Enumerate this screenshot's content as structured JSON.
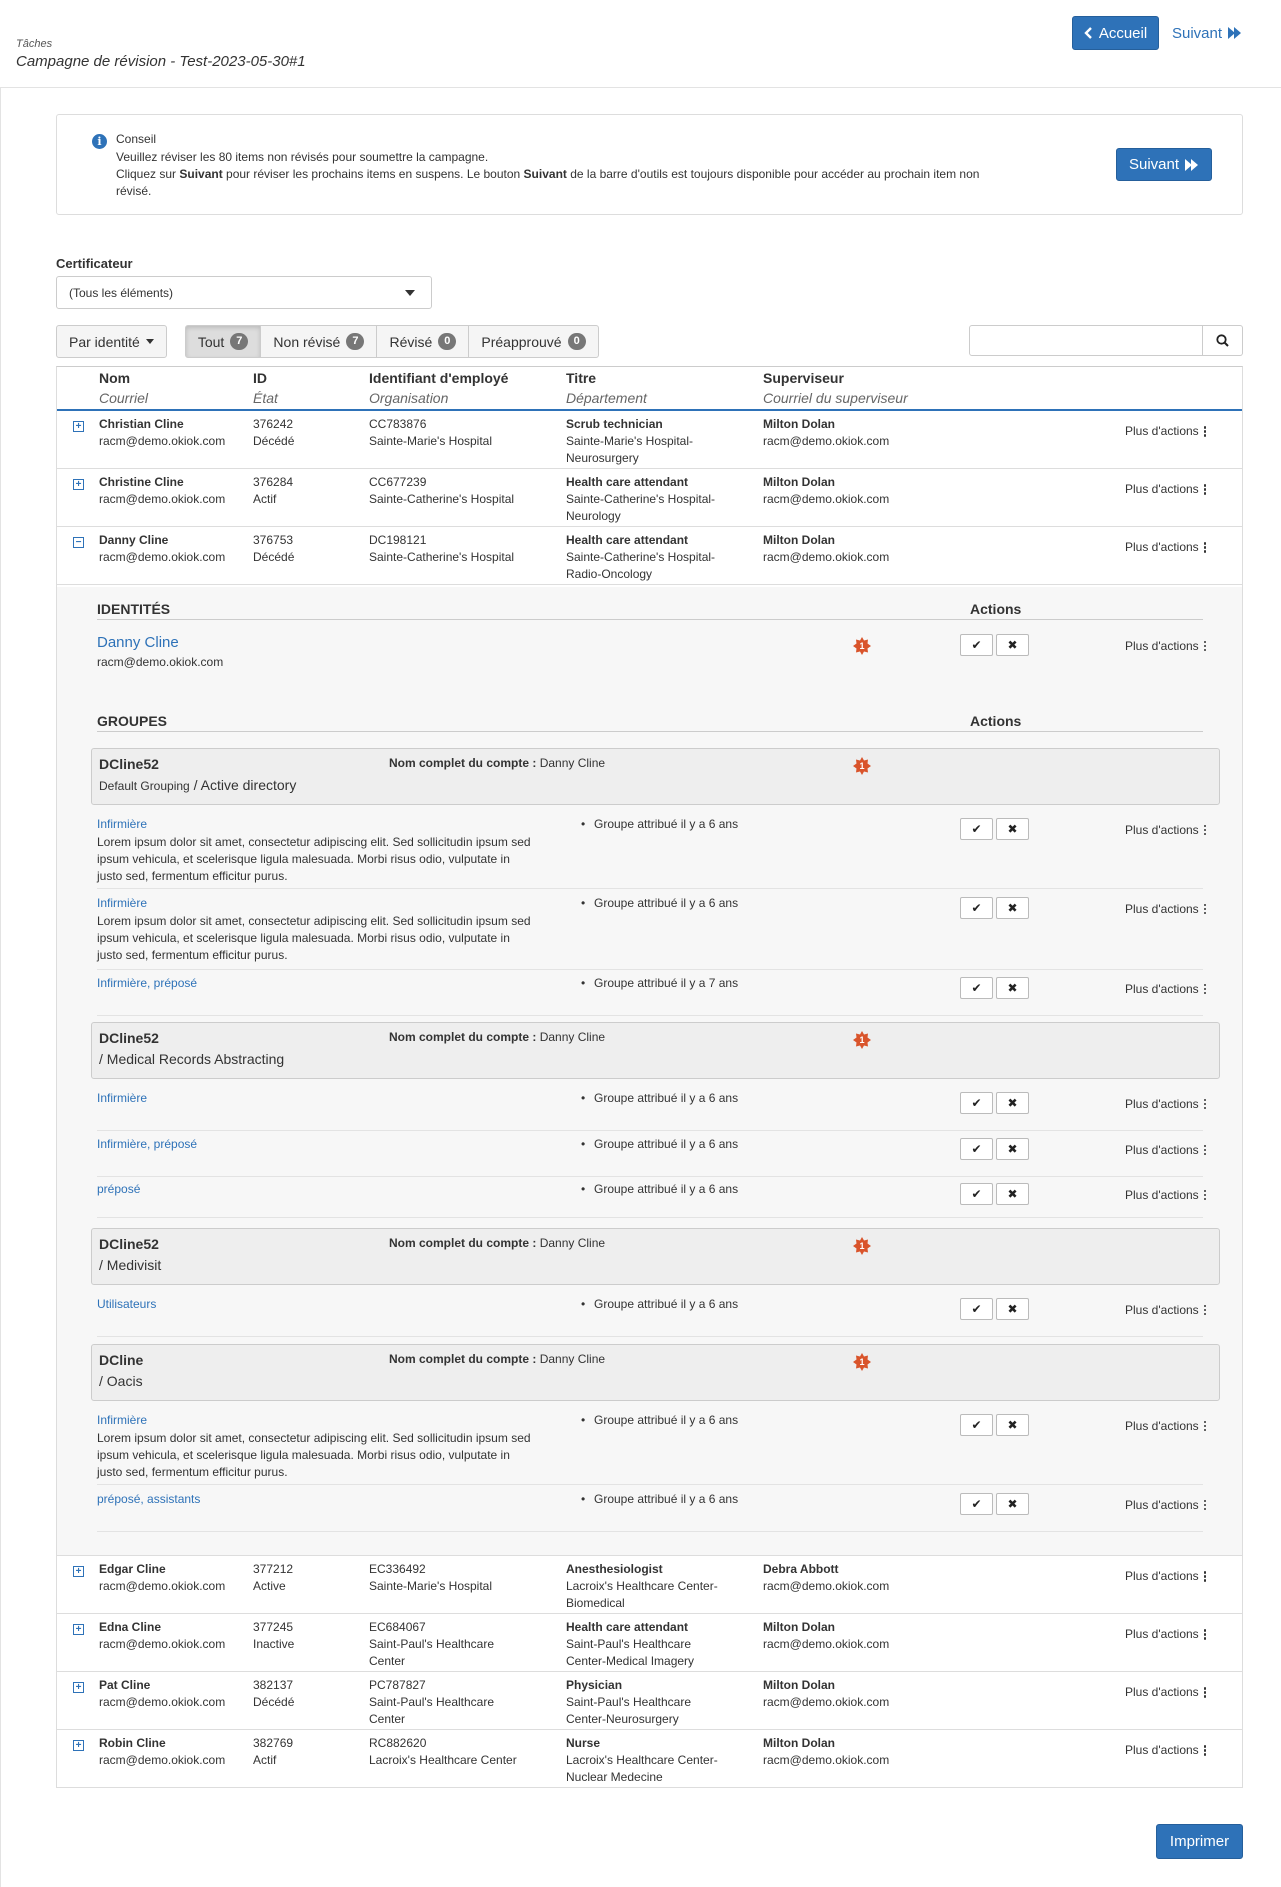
{
  "header": {
    "breadcrumb": "Tâches",
    "title": "Campagne de révision - Test-2023-05-30#1",
    "accueil_label": "Accueil",
    "suivant_label": "Suivant"
  },
  "tip": {
    "title": "Conseil",
    "line1": "Veuillez réviser les 80 items non révisés pour soumettre la campagne.",
    "line2_a": "Cliquez sur ",
    "line2_b": "Suivant",
    "line2_c": " pour réviser les prochains items en suspens. Le bouton ",
    "line2_d": "Suivant",
    "line2_e": " de la barre d'outils est toujours disponible pour accéder au prochain item non révisé.",
    "button_label": "Suivant"
  },
  "certificateur": {
    "label": "Certificateur",
    "selected": "(Tous les éléments)"
  },
  "filters": {
    "par_identite": "Par identité",
    "tout": "Tout",
    "tout_count": "7",
    "non_revise": "Non révisé",
    "non_revise_count": "7",
    "revise": "Révisé",
    "revise_count": "0",
    "preapprouve": "Préapprouvé",
    "preapprouve_count": "0"
  },
  "columns": {
    "nom": "Nom",
    "courriel": "Courriel",
    "id": "ID",
    "etat": "État",
    "employe": "Identifiant d'employé",
    "organisation": "Organisation",
    "titre": "Titre",
    "departement": "Département",
    "superviseur": "Superviseur",
    "courriel_sup": "Courriel du superviseur"
  },
  "more_actions": "Plus d'actions",
  "rows_top": [
    {
      "name": "Christian Cline",
      "email": "racm@demo.okiok.com",
      "id": "376242",
      "state": "Décédé",
      "emp": "CC783876",
      "org": "Sainte-Marie's Hospital",
      "title": "Scrub technician",
      "dept": "Sainte-Marie's Hospital-Neurosurgery",
      "sup": "Milton Dolan",
      "sup_email": "racm@demo.okiok.com",
      "expander": "+"
    },
    {
      "name": "Christine Cline",
      "email": "racm@demo.okiok.com",
      "id": "376284",
      "state": "Actif",
      "emp": "CC677239",
      "org": "Sainte-Catherine's Hospital",
      "title": "Health care attendant",
      "dept": "Sainte-Catherine's Hospital-Neurology",
      "sup": "Milton Dolan",
      "sup_email": "racm@demo.okiok.com",
      "expander": "+"
    },
    {
      "name": "Danny Cline",
      "email": "racm@demo.okiok.com",
      "id": "376753",
      "state": "Décédé",
      "emp": "DC198121",
      "org": "Sainte-Catherine's Hospital",
      "title": "Health care attendant",
      "dept": "Sainte-Catherine's Hospital-Radio-Oncology",
      "sup": "Milton Dolan",
      "sup_email": "racm@demo.okiok.com",
      "expander": "−"
    }
  ],
  "detail": {
    "identites_label": "IDENTITÉS",
    "actions_label": "Actions",
    "identity_name": "Danny Cline",
    "identity_email": "racm@demo.okiok.com",
    "groupes_label": "GROUPES",
    "full_name_label": "Nom complet du compte :",
    "full_name_value": "Danny Cline",
    "burst_count": "1",
    "groups": [
      {
        "name": "DCline52",
        "sub_a": "Default Grouping",
        "sub_b": " / Active directory"
      },
      {
        "name": "DCline52",
        "sub_a": "",
        "sub_b": "/ Medical Records Abstracting"
      },
      {
        "name": "DCline52",
        "sub_a": "",
        "sub_b": "/ Medivisit"
      },
      {
        "name": "DCline",
        "sub_a": "",
        "sub_b": "/ Oacis"
      }
    ],
    "lorem": "Lorem ipsum dolor sit amet, consectetur adipiscing elit. Sed sollicitudin ipsum sed ipsum vehicula, et scelerisque ligula malesuada. Morbi risus odio, vulputate in justo sed, fermentum efficitur purus.",
    "entries": [
      {
        "name": "Infirmière",
        "assigned": "Groupe attribué il y a 6 ans"
      },
      {
        "name": "Infirmière",
        "assigned": "Groupe attribué il y a 6 ans"
      },
      {
        "name": "Infirmière, préposé",
        "assigned": "Groupe attribué il y a 7 ans"
      },
      {
        "name": "Infirmière",
        "assigned": "Groupe attribué il y a 6 ans"
      },
      {
        "name": "Infirmière, préposé",
        "assigned": "Groupe attribué il y a 6 ans"
      },
      {
        "name": "préposé",
        "assigned": "Groupe attribué il y a 6 ans"
      },
      {
        "name": "Utilisateurs",
        "assigned": "Groupe attribué il y a 6 ans"
      },
      {
        "name": "Infirmière",
        "assigned": "Groupe attribué il y a 6 ans"
      },
      {
        "name": "préposé, assistants",
        "assigned": "Groupe attribué il y a 6 ans"
      }
    ]
  },
  "rows_bottom": [
    {
      "name": "Edgar Cline",
      "email": "racm@demo.okiok.com",
      "id": "377212",
      "state": "Active",
      "emp": "EC336492",
      "org": "Sainte-Marie's Hospital",
      "title": "Anesthesiologist",
      "dept": "Lacroix's Healthcare Center-Biomedical",
      "sup": "Debra Abbott",
      "sup_email": "racm@demo.okiok.com",
      "expander": "+"
    },
    {
      "name": "Edna Cline",
      "email": "racm@demo.okiok.com",
      "id": "377245",
      "state": "Inactive",
      "emp": "EC684067",
      "org": "Saint-Paul's Healthcare Center",
      "title": "Health care attendant",
      "dept": "Saint-Paul's Healthcare Center-Medical Imagery",
      "sup": "Milton Dolan",
      "sup_email": "racm@demo.okiok.com",
      "expander": "+"
    },
    {
      "name": "Pat Cline",
      "email": "racm@demo.okiok.com",
      "id": "382137",
      "state": "Décédé",
      "emp": "PC787827",
      "org": "Saint-Paul's Healthcare Center",
      "title": "Physician",
      "dept": "Saint-Paul's Healthcare Center-Neurosurgery",
      "sup": "Milton Dolan",
      "sup_email": "racm@demo.okiok.com",
      "expander": "+"
    },
    {
      "name": "Robin Cline",
      "email": "racm@demo.okiok.com",
      "id": "382769",
      "state": "Actif",
      "emp": "RC882620",
      "org": "Lacroix's Healthcare Center",
      "title": "Nurse",
      "dept": "Lacroix's Healthcare Center-Nuclear Medecine",
      "sup": "Milton Dolan",
      "sup_email": "racm@demo.okiok.com",
      "expander": "+"
    }
  ],
  "footer": {
    "print_label": "Imprimer"
  },
  "colors": {
    "primary": "#2e72b8",
    "burst": "#d9542b"
  }
}
